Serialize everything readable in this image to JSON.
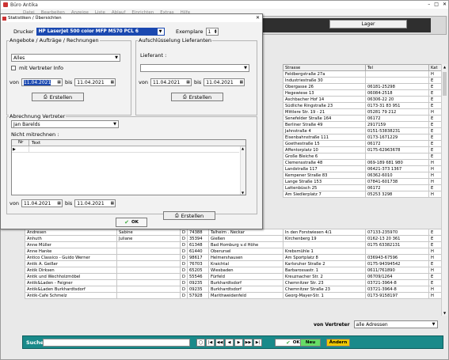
{
  "app": {
    "title": "Büro Antika",
    "menu": [
      "Datei",
      "Bearbeiten",
      "Anzeige",
      "Liste",
      "Ablauf",
      "Einrichten",
      "Extras",
      "Hilfe"
    ]
  },
  "toolbar": {
    "lager_label": "Lager"
  },
  "main_table": {
    "headers": [
      "Strasse",
      "Tel",
      "Kat"
    ],
    "rows_right": [
      [
        "Feldbergstraße 27a",
        "",
        "H"
      ],
      [
        "Industriestraße 30",
        "",
        "E"
      ],
      [
        "Obergasse 26",
        "06181-25298",
        "E"
      ],
      [
        "Hegewiese 13",
        "06084-2518",
        "E"
      ],
      [
        "Aschbacher Hof 14",
        "06306-22 20",
        "E"
      ],
      [
        "Südliche Ringstraße 23",
        "0173-31 83 951",
        "E"
      ],
      [
        "Mittlere Str. 19 - 21",
        "05281 79 212",
        "H"
      ],
      [
        "Senefelder Straße 164",
        "06172",
        "E"
      ],
      [
        "Berliner Straße 49",
        "2917159",
        "E"
      ],
      [
        "Jahnstraße 4",
        "0151-53838231",
        "E"
      ],
      [
        "Eisenbahnstraße 111",
        "0173-1671229",
        "E"
      ],
      [
        "Goethestraße 15",
        "06172",
        "E"
      ],
      [
        "Affentorplatz 10",
        "0175-62963678",
        "E"
      ],
      [
        "Große Bleiche 6",
        "",
        "E"
      ],
      [
        "Clemensstraße 48",
        "069-189 681 980",
        "H"
      ],
      [
        "Landstraße 117",
        "06421-373 1367",
        "H"
      ],
      [
        "Kempener Straße 83",
        "06362-6010",
        "H"
      ],
      [
        "Lange Straße 153",
        "07841-601738",
        "H"
      ],
      [
        "Lattenbüsch 25",
        "06172",
        "E"
      ],
      [
        "Am Siedlerplatz 7",
        "05253 3298",
        "H"
      ]
    ],
    "rows_full": [
      [
        "Andresen",
        "Sabine",
        "D",
        "74388",
        "Talheim . Neckar",
        "In den Forstwiesen 4/1",
        "07133-235970",
        "E"
      ],
      [
        "Anhuth",
        "Juliane",
        "D",
        "35394",
        "Gießen",
        "Kirchenberg 19",
        "0162-13 20 361",
        "E"
      ],
      [
        "Anne Müller",
        "",
        "D",
        "61348",
        "Bad Homburg v.d Höhe",
        "",
        "0175 63382131",
        "E"
      ],
      [
        "Anne Hanke",
        "",
        "D",
        "61440",
        "Oberursel",
        "Krebsmühle 1",
        "",
        "H"
      ],
      [
        "Antico Classico - Guido Werner",
        "",
        "D",
        "98617",
        "Helmershausen",
        "Am Sportplatz 8",
        "036943-67596",
        "H"
      ],
      [
        "Antik A. Geißer",
        "",
        "D",
        "76703",
        "Kraichtal",
        "Karlsruher Straße 2",
        "0175-94394542",
        "E"
      ],
      [
        "Antik Dirksen",
        "",
        "D",
        "65205",
        "Wiesbaden",
        "Barbarossastr. 1",
        "0611/761890",
        "H"
      ],
      [
        "Antik und Wechholzmöbel",
        "",
        "D",
        "55546",
        "Fürfeld",
        "Kreuznacher Str. 2",
        "06709/1264",
        "E"
      ],
      [
        "Antik&Laden - Feigner",
        "",
        "D",
        "09235",
        "Burkhardtsdorf",
        "Chemnitzer Str. 23",
        "03721-3964-8",
        "E"
      ],
      [
        "Antik&Laden Burkhardtsdorf",
        "",
        "D",
        "09235",
        "Burkhardtsdorf",
        "Chemnitzer Straße 23",
        "03721-3964-8",
        "H"
      ],
      [
        "Antik-Cafe Schmelz",
        "",
        "D",
        "57928",
        "Marithweidenfeld",
        "Georg-Mayer-Str. 1",
        "0173-9158197",
        "H"
      ]
    ]
  },
  "bottom": {
    "vertreter_label": "von Vertreter",
    "vertreter_value": "alle Adressen",
    "search_label": "Suche",
    "search_value": "",
    "ok_label": "OK",
    "neu_label": "Neu",
    "aendern_label": "Ändern"
  },
  "dialog": {
    "title": "Statistiken / Übersichten",
    "drucker_label": "Drucker",
    "drucker_value": "HP LaserJet 500 color MFP M570 PCL 6",
    "exemplare_label": "Exemplare",
    "exemplare_value": "1",
    "left_group_title": "Angebote / Aufträge / Rechnungen",
    "left_select_value": "Alles",
    "vertreter_info_label": "mit Vertreter Info",
    "von_label": "von",
    "bis_label": "bis",
    "date_from": "11.04.2021",
    "date_to": "11.04.2021",
    "erstellen_label": "Erstellen",
    "right_group_title": "Aufschlüsselung Lieferanten",
    "lieferant_label": "Lieferant :",
    "lieferant_value": "",
    "right_date_from": "11.04.2021",
    "right_date_to": "11.04.2021",
    "abrechnung_title": "Abrechnung Vertreter",
    "vertreter_select_value": "Jan Barelds",
    "nicht_mitrechnen_label": "Nicht mitrechnen :",
    "grid_headers": [
      "Nr",
      "Text"
    ],
    "bottom_date_from": "11.04.2021",
    "bottom_date_to": "11.04.2021",
    "ok_label": "OK"
  },
  "colors": {
    "title_bar": "#2a5bc2",
    "teal_bar": "#1a8a8a",
    "ok_green": "#3fa83f",
    "neu_green": "#66dd66",
    "aendern_yellow": "#f0c800"
  }
}
